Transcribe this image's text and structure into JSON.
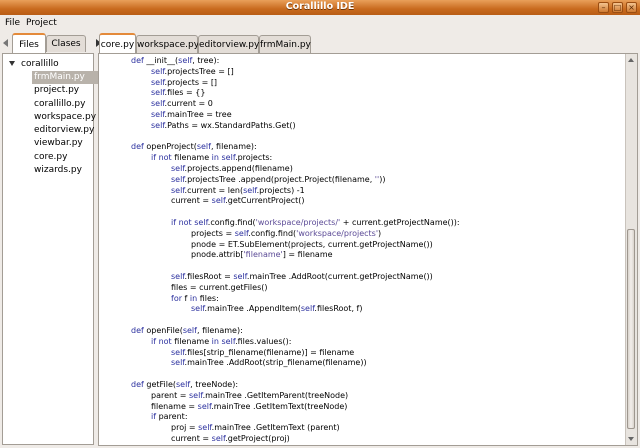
{
  "window": {
    "title": "Corallillo IDE"
  },
  "menu": {
    "items": [
      "File",
      "Project"
    ]
  },
  "left_tabs": {
    "files": "Files",
    "classes": "Clases"
  },
  "tree": {
    "root": "corallillo",
    "items": [
      "frmMain.py",
      "project.py",
      "corallillo.py",
      "workspace.py",
      "editorview.py",
      "viewbar.py",
      "core.py",
      "wizards.py"
    ],
    "selected_index": 0
  },
  "editor_tabs": [
    "core.py",
    "workspace.py",
    "editorview.py",
    "frmMain.py"
  ],
  "active_editor_tab": 0,
  "code_lines": [
    {
      "indent": 1,
      "text": "def __init__(self, tree):"
    },
    {
      "indent": 2,
      "text": "self.projectsTree = []"
    },
    {
      "indent": 2,
      "text": "self.projects = []"
    },
    {
      "indent": 2,
      "text": "self.files = {}"
    },
    {
      "indent": 2,
      "text": "self.current = 0"
    },
    {
      "indent": 2,
      "text": "self.mainTree = tree"
    },
    {
      "indent": 2,
      "text": "self.Paths = wx.StandardPaths.Get()"
    },
    {
      "indent": 0,
      "text": ""
    },
    {
      "indent": 1,
      "text": "def openProject(self, filename):"
    },
    {
      "indent": 2,
      "text": "if not filename in self.projects:"
    },
    {
      "indent": 3,
      "text": "self.projects.append(filename)"
    },
    {
      "indent": 3,
      "text": "self.projectsTree .append(project.Project(filename, ''))"
    },
    {
      "indent": 3,
      "text": "self.current = len(self.projects) -1"
    },
    {
      "indent": 3,
      "text": "current = self.getCurrentProject()"
    },
    {
      "indent": 0,
      "text": ""
    },
    {
      "indent": 3,
      "text": "if not self.config.find('workspace/projects/' + current.getProjectName()):"
    },
    {
      "indent": 4,
      "text": "projects = self.config.find('workspace/projects')"
    },
    {
      "indent": 4,
      "text": "pnode = ET.SubElement(projects, current.getProjectName())"
    },
    {
      "indent": 4,
      "text": "pnode.attrib['filename'] = filename"
    },
    {
      "indent": 0,
      "text": ""
    },
    {
      "indent": 3,
      "text": "self.filesRoot = self.mainTree .AddRoot(current.getProjectName())"
    },
    {
      "indent": 3,
      "text": "files = current.getFiles()"
    },
    {
      "indent": 3,
      "text": "for f in files:"
    },
    {
      "indent": 4,
      "text": "self.mainTree .AppendItem(self.filesRoot, f)"
    },
    {
      "indent": 0,
      "text": ""
    },
    {
      "indent": 1,
      "text": "def openFile(self, filename):"
    },
    {
      "indent": 2,
      "text": "if not filename in self.files.values():"
    },
    {
      "indent": 3,
      "text": "self.files[strip_filename(filename)] = filename"
    },
    {
      "indent": 3,
      "text": "self.mainTree .AddRoot(strip_filename(filename))"
    },
    {
      "indent": 0,
      "text": ""
    },
    {
      "indent": 1,
      "text": "def getFile(self, treeNode):"
    },
    {
      "indent": 2,
      "text": "parent = self.mainTree .GetItemParent(treeNode)"
    },
    {
      "indent": 2,
      "text": "filename = self.mainTree .GetItemText(treeNode)"
    },
    {
      "indent": 2,
      "text": "if parent:"
    },
    {
      "indent": 3,
      "text": "proj = self.mainTree .GetItemText (parent)"
    },
    {
      "indent": 3,
      "text": "current = self.getProject(proj)"
    }
  ]
}
